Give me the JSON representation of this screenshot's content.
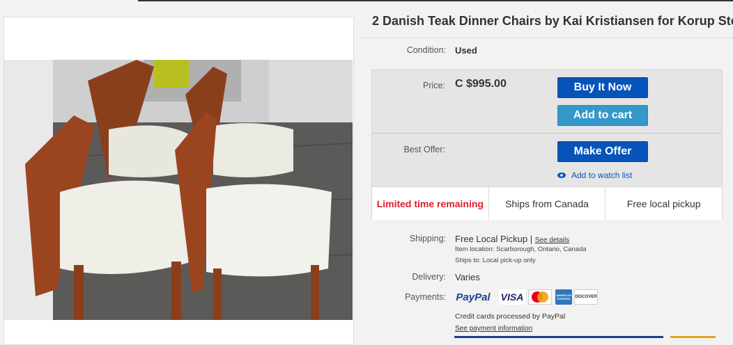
{
  "listing": {
    "title": "2 Danish Teak Dinner Chairs by Kai Kristiansen for Korup Sto",
    "condition_label": "Condition:",
    "condition_value": "Used"
  },
  "pricing": {
    "price_label": "Price:",
    "price_value": "C $995.00",
    "buy_now_label": "Buy It Now",
    "add_to_cart_label": "Add to cart",
    "best_offer_label": "Best Offer:",
    "make_offer_label": "Make Offer",
    "watch_label": "Add to watch list"
  },
  "features": [
    {
      "label": "Limited time remaining",
      "urgent": true
    },
    {
      "label": "Ships from Canada",
      "urgent": false
    },
    {
      "label": "Free local pickup",
      "urgent": false
    }
  ],
  "shipping": {
    "label": "Shipping:",
    "value": "Free Local Pickup",
    "separator": "|",
    "details_link": "See details",
    "item_location": "Item location:  Scarborough, Ontario, Canada",
    "ships_to": "Ships to:  Local pick-up only"
  },
  "delivery": {
    "label": "Delivery:",
    "value": "Varies"
  },
  "payments": {
    "label": "Payments:",
    "paypal": "PayPal",
    "visa": "VISA",
    "mastercard": "MasterCard",
    "amex": "AMERICAN EXPRESS",
    "discover": "DISCOVER",
    "note": "Credit cards processed by PayPal",
    "info_link": "See payment information"
  },
  "colors": {
    "primary_button": "#0654ba",
    "secondary_button": "#3498ca",
    "urgent": "#dd1e31"
  }
}
